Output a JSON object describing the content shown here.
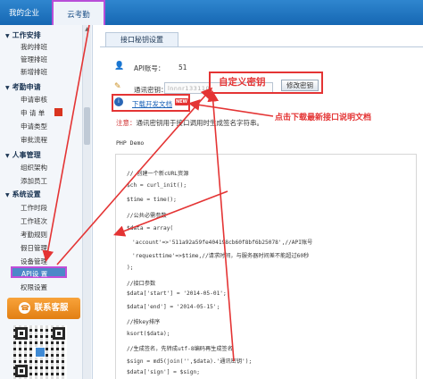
{
  "topbar": {
    "tab1": "我的企业",
    "tab2": "云考勤"
  },
  "sidebar": {
    "groups": [
      {
        "title": "工作安排",
        "items": [
          "我的排班",
          "管理排班",
          "新增排班"
        ]
      },
      {
        "title": "考勤申请",
        "items": [
          "申请审核",
          "申 请 单",
          "申请类型",
          "审批流程"
        ]
      },
      {
        "title": "人事管理",
        "items": [
          "组织架构",
          "添加员工"
        ]
      },
      {
        "title": "系统设置",
        "items": [
          "工作时段",
          "工作班次",
          "考勤规则",
          "假日管理",
          "设备管理",
          "API设 置",
          "权限设置"
        ]
      }
    ],
    "service_button": "联系客服"
  },
  "page": {
    "tab": "接口秘钥设置",
    "api_label": "API账号：",
    "api_value": "51",
    "secret_label": "通讯密钥：",
    "secret_masked": "lnnnr133110",
    "reset_button": "修改密钥",
    "doc_link": "下载开发文档",
    "new_badge": "NEW",
    "note_label": "注意：",
    "note_text": "通讯密钥用于接口调用时生成签名字符串。",
    "php_title": "PHP Demo"
  },
  "annotations": {
    "custom_secret": "自定义密钥",
    "download_doc": "点击下载最新接口说明文档"
  },
  "code_lines": [
    "// 创建一个新cURL资源",
    "$ch = curl_init();",
    "$time = time();",
    "//公共必需参数",
    "$data = array(",
    "'account'=>'511a92a59fe404198cb60f8bf6b25078',//API账号",
    "'requesttime'=>$time,//请求时间，与服务器时间差不能超过60秒",
    ");",
    "//接口参数",
    "$data['start'] = '2014-05-01';",
    "$data['end'] = '2014-05-15';",
    "//按key排序",
    "ksort($data);",
    "//生成签名，先转成utf-8编码再生成签名",
    "$sign = md5(join('',$data).'通讯密钥');",
    "$data['sign'] = $sign;"
  ],
  "colors": {
    "topbar": "#1667b3",
    "annotation": "#e43434",
    "highlight": "#c04ed8",
    "service": "#e27f13"
  }
}
